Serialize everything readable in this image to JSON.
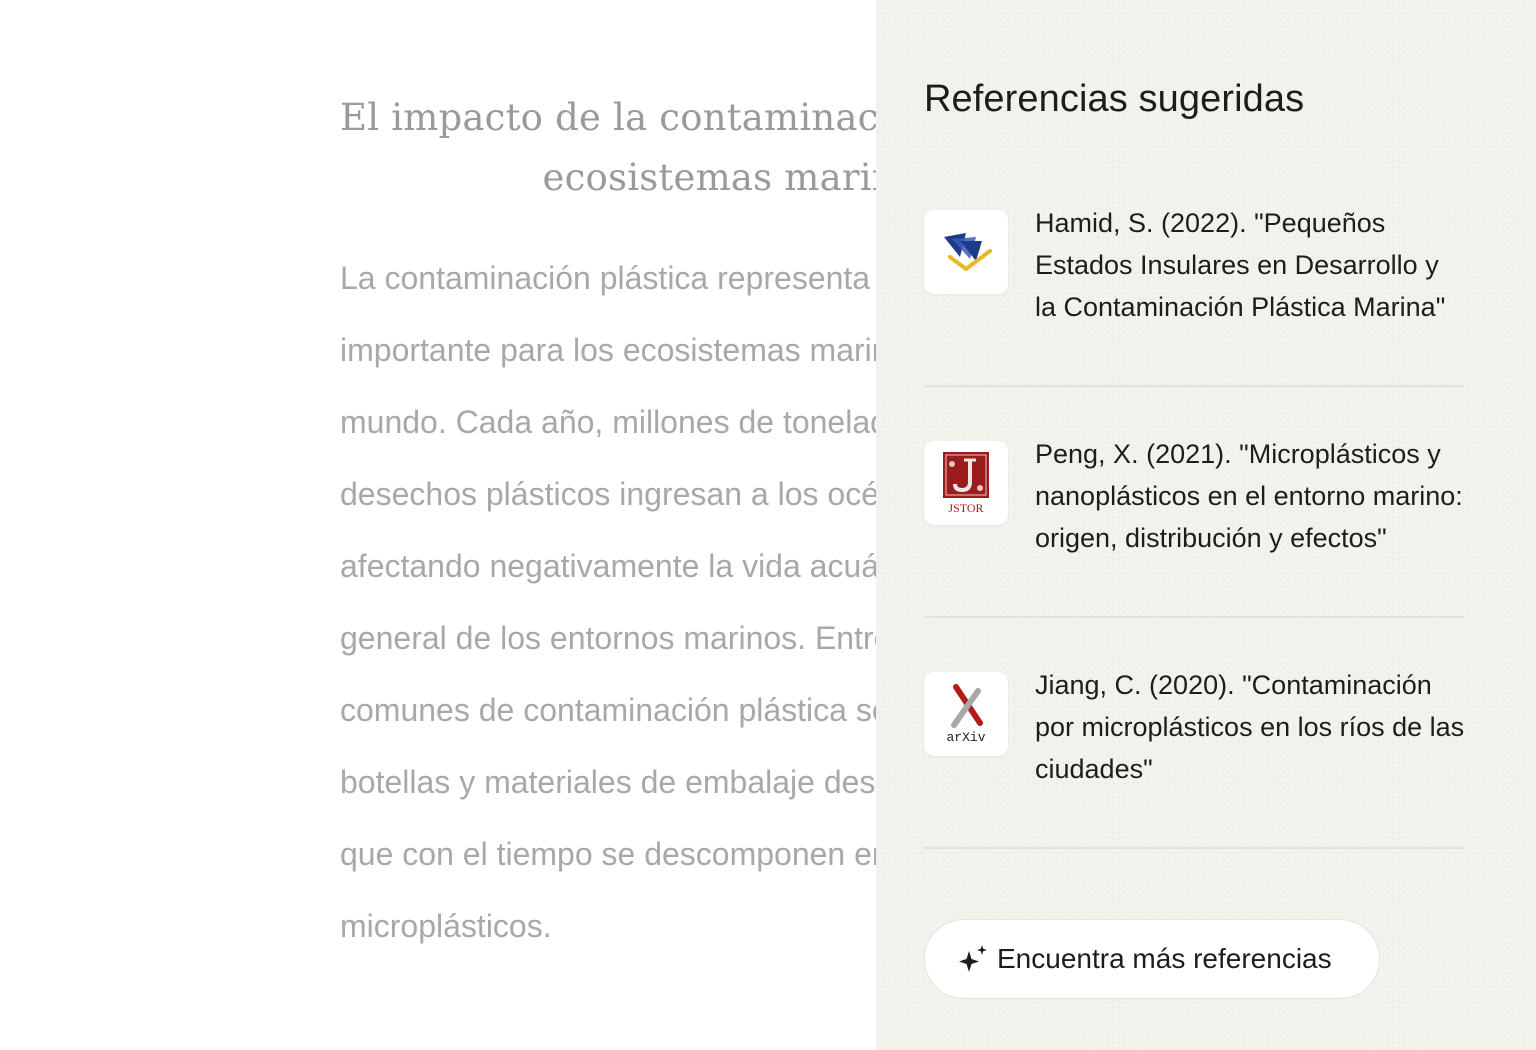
{
  "document": {
    "title_lines": [
      "El impacto de la contaminación plástica en los",
      "ecosistemas marinos"
    ],
    "body_lines": [
      "La contaminación plástica representa una amenaza",
      "importante para los ecosistemas marinos de todo el",
      "mundo. Cada año, millones de toneladas de",
      "desechos plásticos ingresan a los océanos,",
      "afectando negativamente la vida acuática y la salud",
      "general de los entornos marinos. Entre las fuentes",
      "comunes de contaminación plástica se encuentran",
      "botellas y materiales de embalaje desechables,",
      "que con el tiempo se descomponen en",
      "microplásticos."
    ]
  },
  "panel": {
    "title": "Referencias sugeridas",
    "references": [
      {
        "source_icon": "document-source-icon",
        "text": "Hamid, S. (2022). \"Pequeños Estados Insulares en Desarrollo y la Contaminación Plástica Marina\""
      },
      {
        "source_icon": "jstor-logo",
        "source_label": "JSTOR",
        "text": "Peng, X. (2021). \"Microplásticos y nanoplásticos en el entorno marino: origen, distribución y efectos\""
      },
      {
        "source_icon": "arxiv-logo",
        "source_label": "arXiv",
        "text": "Jiang, C. (2020). \"Contaminación por microplásticos en los ríos de las ciudades\""
      }
    ],
    "find_more_label": "Encuentra más referencias",
    "find_more_icon": "sparkle-icon"
  },
  "colors": {
    "panel_background": "#f3f3ee",
    "faded_text": "#a8a8a8",
    "jstor_red": "#9b1c1c",
    "arxiv_red": "#b31b1b"
  }
}
